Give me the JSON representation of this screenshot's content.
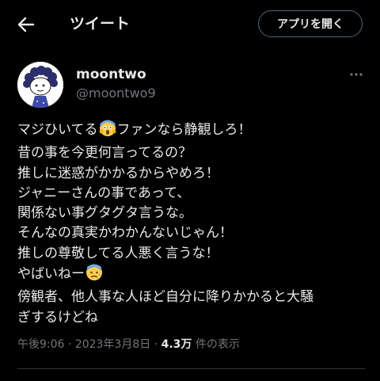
{
  "header": {
    "title": "ツイート",
    "open_app_label": "アプリを開く"
  },
  "user": {
    "display_name": "moontwo",
    "handle": "@moontwo9"
  },
  "tweet": {
    "line1_pre": "マジひいてる",
    "line1_emoji": "screaming-face-emoji",
    "line1_post": "ファンなら静観しろ！",
    "line2": "昔の事を今更何言ってるの？",
    "line3": "推しに迷惑がかかるからやめろ！",
    "line4": "ジャニーさんの事であって、",
    "line5": "関係ない事グタグタ言うな。",
    "line6": "そんなの真実かわかんないじゃん！",
    "line7": "推しの尊敬してる人悪く言うな！",
    "line8_pre": "やばいねー",
    "line8_emoji": "anxious-face-emoji",
    "line9": "傍観者、他人事な人ほど自分に降りかかると大騒",
    "line10": "ぎするけどね"
  },
  "meta": {
    "time": "午後9:06",
    "separator": "·",
    "date": "2023年3月8日",
    "views": "4.3万",
    "views_suffix": "件の表示"
  },
  "colors": {
    "background": "#000000",
    "text": "#e7e9ea",
    "secondary": "#71767b",
    "border": "#536471",
    "emoji_yellow": "#ffcc4d"
  }
}
